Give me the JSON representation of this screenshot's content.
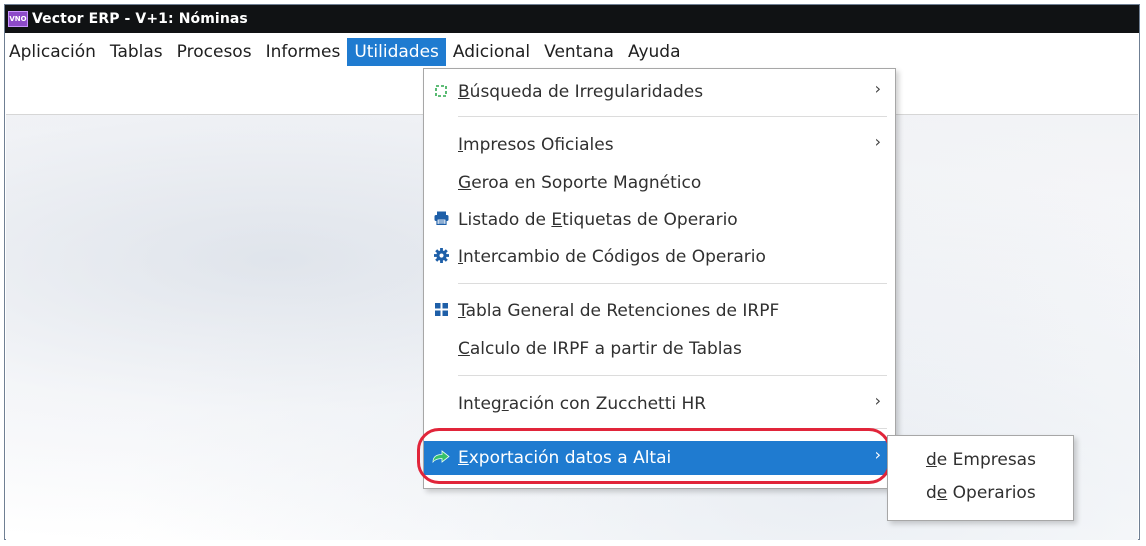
{
  "window": {
    "app_icon_text": "VNO",
    "title": "Vector ERP - V+1: Nóminas"
  },
  "menubar": [
    "Aplicación",
    "Tablas",
    "Procesos",
    "Informes",
    "Utilidades",
    "Adicional",
    "Ventana",
    "Ayuda"
  ],
  "menu_active": "Utilidades",
  "dropdown": {
    "busqueda": {
      "icon": "dashed-square-icon",
      "mnemonic": "B",
      "rest": "úsqueda de Irregularidades",
      "arrow": "›"
    },
    "impresos": {
      "mnemonic": "I",
      "rest": "mpresos Oficiales",
      "arrow": "›"
    },
    "geroa": {
      "mnemonic": "G",
      "rest": "eroa en Soporte Magnético"
    },
    "listado": {
      "icon": "printer-icon",
      "pre": "Listado de ",
      "mnemonic": "E",
      "rest": "tiquetas de Operario"
    },
    "intercambio": {
      "icon": "gear-icon",
      "mnemonic": "I",
      "rest": "ntercambio de Códigos de Operario"
    },
    "tabla": {
      "icon": "grid-icon",
      "mnemonic": "T",
      "rest": "abla General de Retenciones de IRPF"
    },
    "calculo": {
      "mnemonic": "C",
      "rest": "alculo de IRPF a partir de Tablas"
    },
    "integracion": {
      "pre": "Integ",
      "mnemonic": "r",
      "rest": "ación con Zucchetti HR",
      "arrow": "›"
    },
    "exportacion": {
      "icon": "export-arrow-icon",
      "mnemonic": "E",
      "rest": "xportación datos a Altai",
      "arrow": "›"
    }
  },
  "submenu": {
    "empresas": {
      "mnemonic": "d",
      "rest": "e Empresas"
    },
    "operarios": {
      "pre": "d",
      "mnemonic": "e",
      "rest": " Operarios"
    }
  },
  "colors": {
    "accent": "#1f7bd0",
    "highlight_ring": "#e1253a",
    "titlebar": "#101214"
  }
}
